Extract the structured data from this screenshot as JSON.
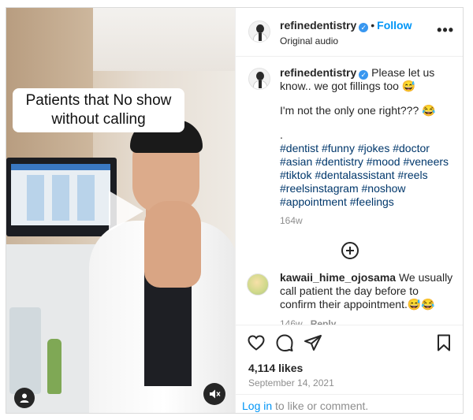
{
  "media": {
    "caption_line1": "Patients that No show",
    "caption_line2": "without calling"
  },
  "header": {
    "username": "refinedentistry",
    "verified_mark": "✓",
    "separator": "•",
    "follow_label": "Follow",
    "audio_label": "Original audio",
    "more_label": "•••"
  },
  "post": {
    "username": "refinedentistry",
    "text_line1": "Please let us know.. we got fillings too 😅",
    "text_line2": "I'm not the only one right??? 😂",
    "text_line3": ".",
    "hashtags": [
      "#dentist",
      "#funny",
      "#jokes",
      "#doctor",
      "#asian",
      "#dentistry",
      "#mood",
      "#veneers",
      "#tiktok",
      "#dentalassistant",
      "#reels",
      "#reelsinstagram",
      "#noshow",
      "#appointment",
      "#feelings"
    ],
    "time": "164w"
  },
  "comment": {
    "username": "kawaii_hime_ojosama",
    "text": "We usually call patient the day before to confirm their appointment.😅😂",
    "time": "146w",
    "reply_label": "Reply"
  },
  "actions": {
    "likes": "4,114 likes",
    "date": "September 14, 2021"
  },
  "footer": {
    "login_link": "Log in",
    "login_text": " to like or comment."
  },
  "colors": {
    "link_blue": "#0095f6",
    "hashtag_blue": "#00376b",
    "verified_blue": "#3897f0",
    "muted_grey": "#8e8e8e"
  },
  "icons": [
    "play-icon",
    "user-icon",
    "mute-icon",
    "verified-icon",
    "more-icon",
    "add-comment-icon",
    "heart-icon",
    "comment-icon",
    "share-icon",
    "bookmark-icon"
  ]
}
